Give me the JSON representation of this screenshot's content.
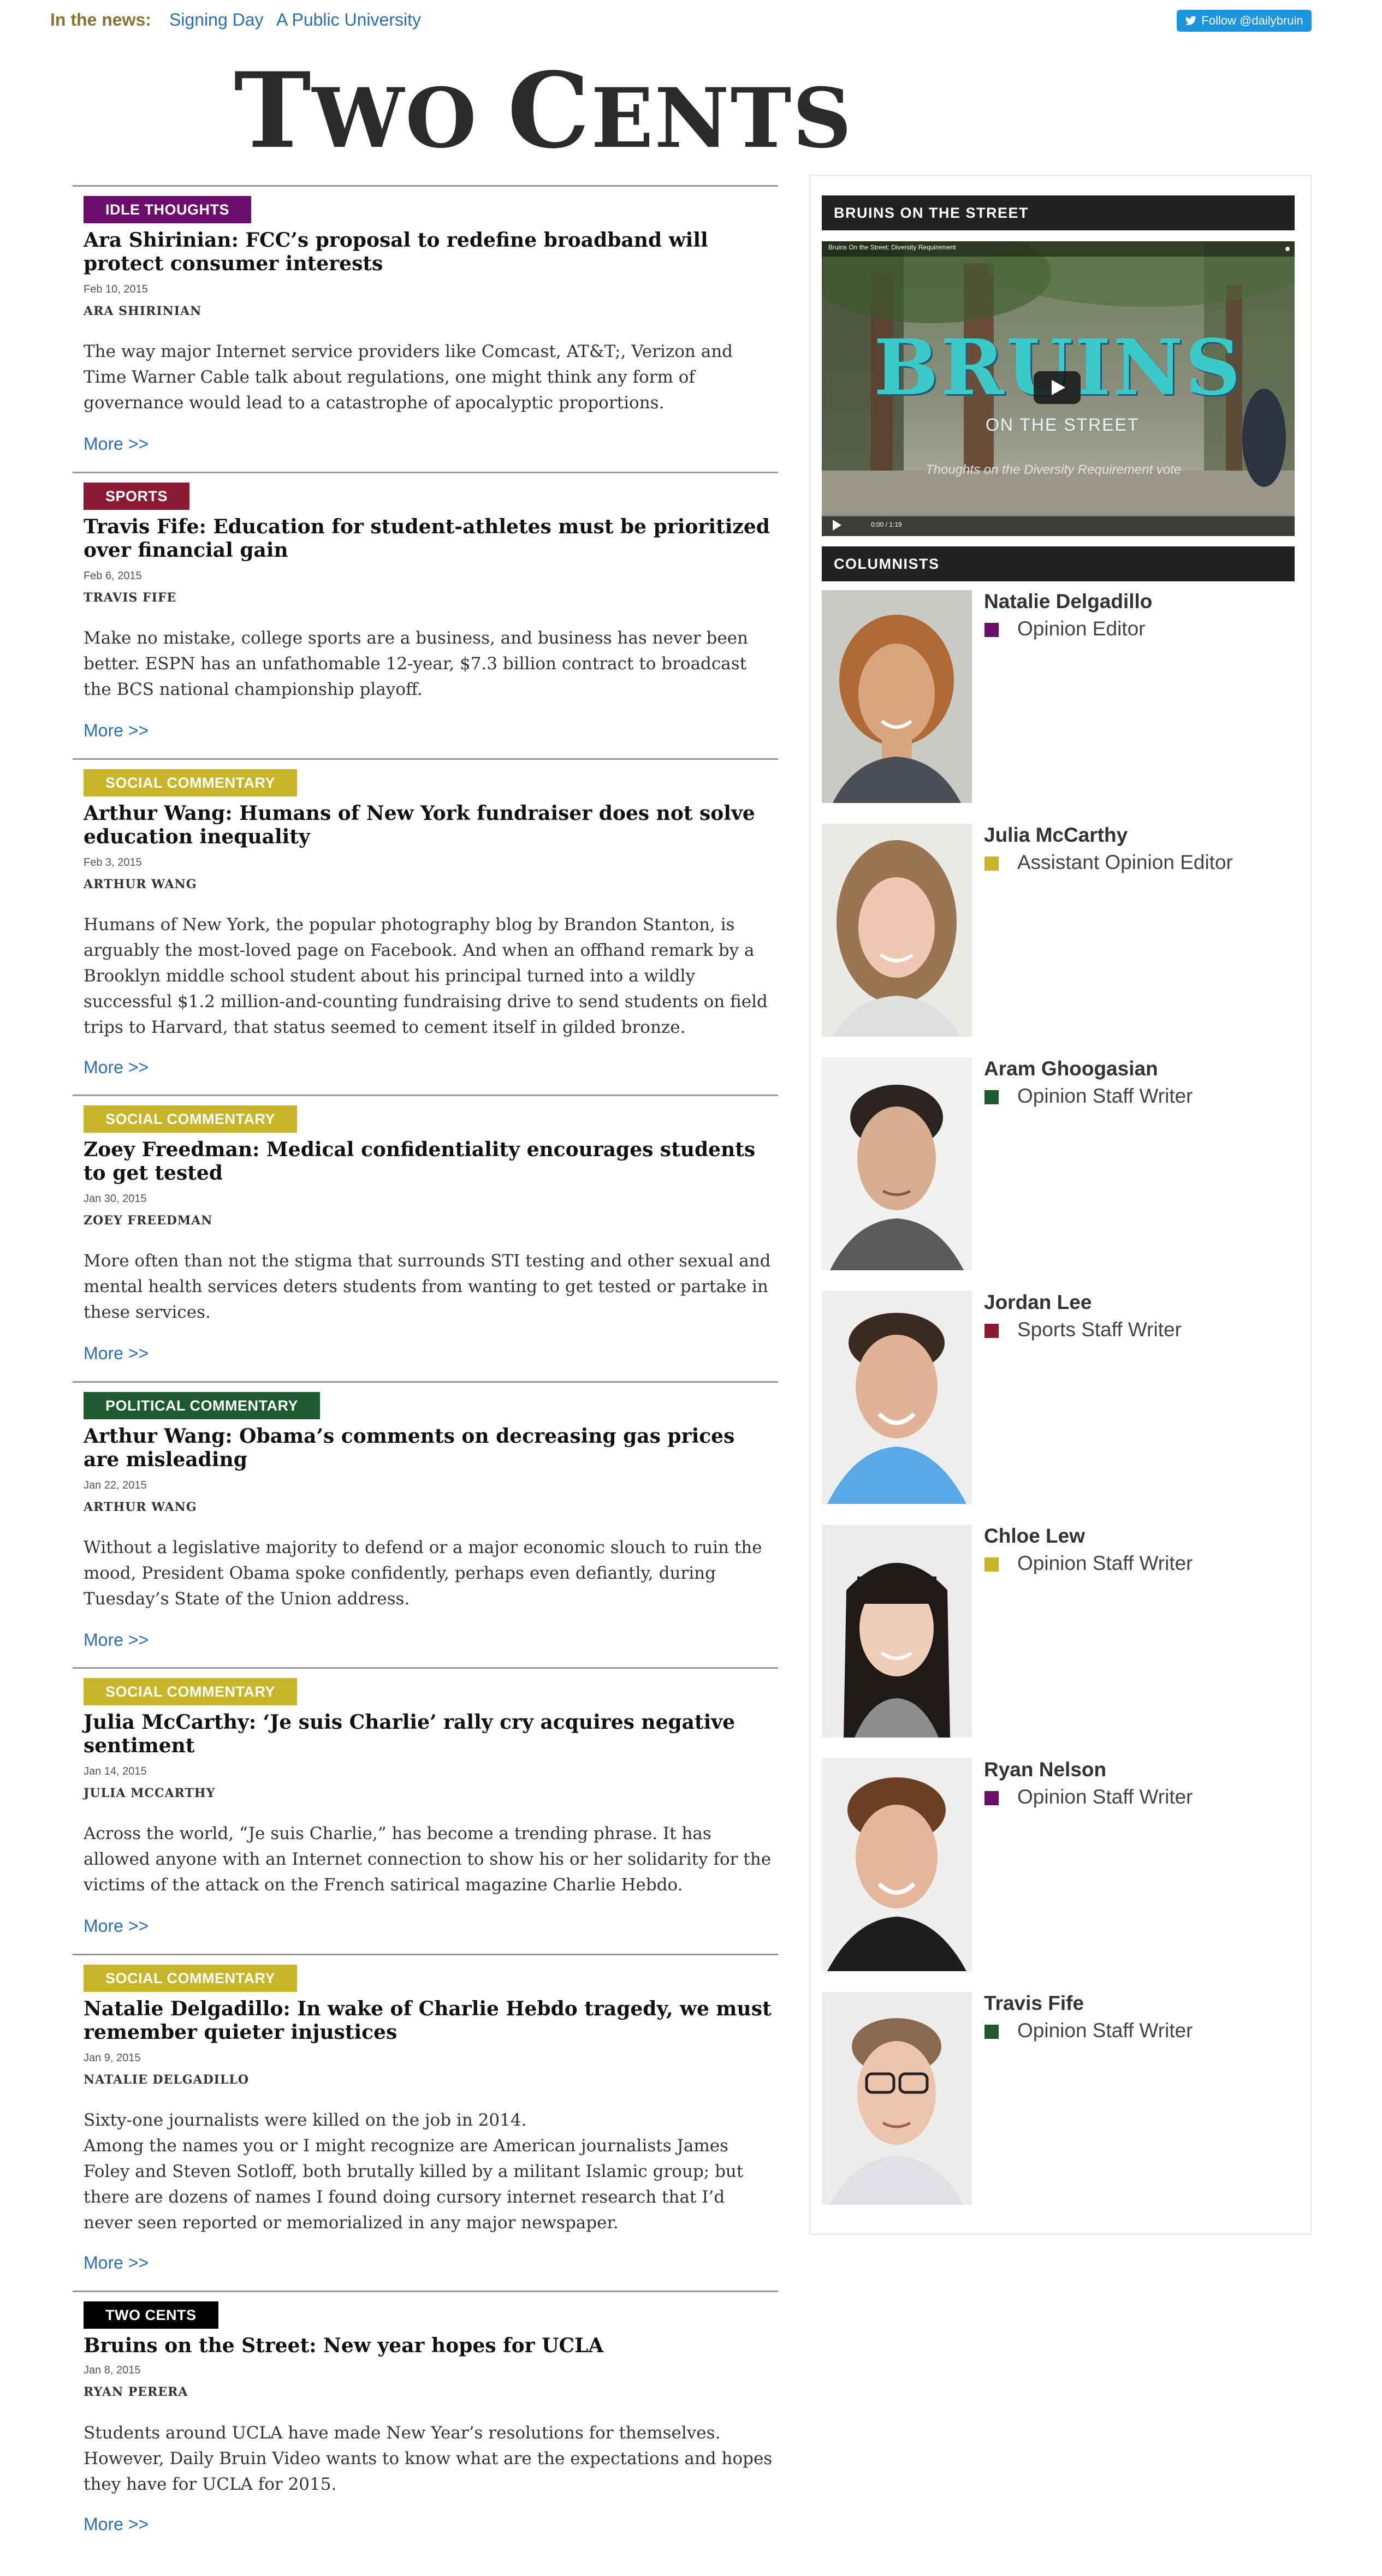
{
  "topbar": {
    "news_label": "In the news:",
    "links": [
      "Signing Day",
      "A Public University"
    ],
    "follow_label": "Follow @dailybruin"
  },
  "masthead": {
    "first_initial": "T",
    "first_rest": "WO ",
    "second_initial": "C",
    "second_rest": "ENTS"
  },
  "colors": {
    "idle_thoughts": "#6b0d6b",
    "sports": "#8b1a35",
    "social_commentary": "#c6b628",
    "political_commentary": "#1d5a2f",
    "two_cents": "#000000",
    "link": "#2a6fb3"
  },
  "articles": [
    {
      "tag": "IDLE THOUGHTS",
      "headline": "Ara Shirinian: FCC’s proposal to redefine broadband will protect consumer interests",
      "date": "Feb 10, 2015",
      "author": "ARA SHIRINIAN",
      "excerpt": "The way major Internet service providers like Comcast, AT&T;, Verizon and Time Warner Cable talk about regulations, one might think any form of governance would lead to a catastrophe of apocalyptic proportions.",
      "more": "More >>"
    },
    {
      "tag": "SPORTS",
      "headline": "Travis Fife: Education for student-athletes must be prioritized over financial gain",
      "date": "Feb 6, 2015",
      "author": "TRAVIS FIFE",
      "excerpt": "Make no mistake, college sports are a business, and business has never been better. ESPN has an unfathomable 12-year, $7.3 billion contract to broadcast the BCS national championship playoff.",
      "more": "More >>"
    },
    {
      "tag": "SOCIAL COMMENTARY",
      "headline": "Arthur Wang: Humans of New York fundraiser does not solve education inequality",
      "date": "Feb 3, 2015",
      "author": "ARTHUR WANG",
      "excerpt": "Humans of New York, the popular photography blog by Brandon Stanton, is arguably the most-loved page on Facebook. And when an offhand remark by a Brooklyn middle school student about his principal turned into a wildly successful $1.2 million-and-counting fundraising drive to send students on field trips to Harvard, that status seemed to cement itself in gilded bronze.",
      "more": "More >>"
    },
    {
      "tag": "SOCIAL COMMENTARY",
      "headline": "Zoey Freedman: Medical confidentiality encourages students to get tested",
      "date": "Jan 30, 2015",
      "author": "ZOEY FREEDMAN",
      "excerpt": "More often than not the stigma that surrounds STI testing and other sexual and mental health services deters students from wanting to get tested or partake in these services.",
      "more": "More >>"
    },
    {
      "tag": "POLITICAL COMMENTARY",
      "headline": "Arthur Wang: Obama’s comments on decreasing gas prices are misleading",
      "date": "Jan 22, 2015",
      "author": "ARTHUR WANG",
      "excerpt": "Without a legislative majority to defend or a major economic slouch to ruin the mood, President Obama spoke confidently, perhaps even defiantly, during Tuesday’s State of the Union address.",
      "more": "More >>"
    },
    {
      "tag": "SOCIAL COMMENTARY",
      "headline": "Julia McCarthy: ‘Je suis Charlie’ rally cry acquires negative sentiment",
      "date": "Jan 14, 2015",
      "author": "JULIA MCCARTHY",
      "excerpt": "Across the world, “Je suis Charlie,” has become a trending phrase. It has allowed anyone with an Internet connection to show his or her solidarity for the victims of the attack on the French satirical magazine Charlie Hebdo.",
      "more": "More >>"
    },
    {
      "tag": "SOCIAL COMMENTARY",
      "headline": "Natalie Delgadillo: In wake of Charlie Hebdo tragedy, we must remember quieter injustices",
      "date": "Jan 9, 2015",
      "author": "NATALIE DELGADILLO",
      "excerpt_first": "Sixty-one journalists were killed on the job in 2014.",
      "excerpt": "Among the names you or I might recognize are American journalists James Foley and Steven Sotloff, both brutally killed by a militant Islamic group; but there are dozens of names I found doing cursory internet research that I’d never seen reported or memorialized in any major newspaper.",
      "more": "More >>"
    },
    {
      "tag": "TWO CENTS",
      "headline": "Bruins on the Street: New year hopes for UCLA",
      "date": "Jan 8, 2015",
      "author": "RYAN PERERA",
      "excerpt": "Students around UCLA have made New Year’s resolutions for themselves. However, Daily Bruin Video wants to know what are the expectations and hopes they have for UCLA for 2015.",
      "more": "More >>"
    }
  ],
  "sidebar": {
    "video_heading": "BRUINS ON THE STREET",
    "video": {
      "title": "Bruins On the Street: Diversity Requirement",
      "logo_main": "BRUINS",
      "logo_sub": "ON THE STREET",
      "caption": "Thoughts on the Diversity Requirement vote",
      "time": "0:00 / 1:19",
      "progress": 0
    },
    "columnists_heading": "COLUMNISTS",
    "columnists": [
      {
        "name": "Natalie Delgadillo",
        "role": "Opinion Editor",
        "color": "#6b0d6b"
      },
      {
        "name": "Julia McCarthy",
        "role": "Assistant Opinion Editor",
        "color": "#c6b628"
      },
      {
        "name": "Aram Ghoogasian",
        "role": "Opinion Staff Writer",
        "color": "#1d5a2f"
      },
      {
        "name": "Jordan Lee",
        "role": "Sports Staff Writer",
        "color": "#8b1a35"
      },
      {
        "name": "Chloe Lew",
        "role": "Opinion Staff Writer",
        "color": "#c6b628"
      },
      {
        "name": "Ryan Nelson",
        "role": "Opinion Staff Writer",
        "color": "#6b0d6b"
      },
      {
        "name": "Travis Fife",
        "role": "Opinion Staff Writer",
        "color": "#1d5a2f"
      }
    ]
  }
}
